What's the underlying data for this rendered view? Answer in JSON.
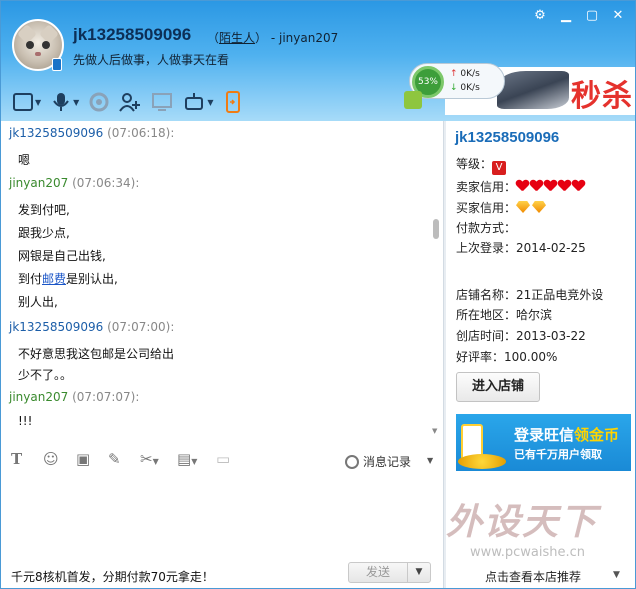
{
  "header": {
    "nickname": "jk13258509096",
    "stranger_label": "陌生人",
    "paren_open": "（",
    "paren_close": "）",
    "self_suffix": " - jinyan207",
    "signature": "先做人后做事，人做事天在看"
  },
  "net_widget": {
    "percent": "53%",
    "up_speed": "0K/s",
    "down_speed": "0K/s"
  },
  "ad_banner": {
    "text": "秒杀"
  },
  "chat": {
    "messages": [
      {
        "sender": "jk13258509096",
        "time": "(07:06:18):",
        "lines": [
          "嗯"
        ]
      },
      {
        "sender": "jinyan207",
        "time": "(07:06:34):",
        "lines": [
          "发到付吧,",
          "跟我少点,",
          "网银是自己出钱,",
          "到付",
          "是别认出,",
          "别人出,"
        ],
        "link": "邮费"
      },
      {
        "sender": "jk13258509096",
        "time": "(07:07:00):",
        "lines": [
          "不好意思我这包邮是公司给出",
          "少不了。。"
        ]
      },
      {
        "sender": "jinyan207",
        "time": "(07:07:07):",
        "lines": [
          "!!!"
        ]
      }
    ]
  },
  "input_toolbar": {
    "history_label": "消息记录"
  },
  "bottom": {
    "promo": "千元8核机首发，分期付款70元拿走！",
    "send_label": "发送"
  },
  "side": {
    "name": "jk13258509096",
    "level_label": "等级：",
    "seller_credit_label": "卖家信用：",
    "seller_hearts": 5,
    "buyer_credit_label": "买家信用：",
    "buyer_diamonds": 2,
    "payment_label": "付款方式：",
    "last_login_label": "上次登录：",
    "last_login": "2014-02-25",
    "shop_name_label": "店铺名称：",
    "shop_name": "21正品电竞外设",
    "region_label": "所在地区：",
    "region": "哈尔滨",
    "created_label": "创店时间：",
    "created": "2013-03-22",
    "rating_label": "好评率：",
    "rating": "100.00%",
    "shop_button": "进入店铺",
    "ad_line1_a": "登录旺信",
    "ad_line1_b": "领金币",
    "ad_line2": "已有千万用户领取",
    "footer": "点击查看本店推荐"
  },
  "watermark": {
    "big": "外设天下",
    "url": "www.pcwaishe.cn"
  },
  "colors": {
    "header_top": "#2b98e4",
    "sender_other": "#1c5ea8",
    "sender_self": "#3a8a2e",
    "accent_red": "#e5322d"
  }
}
